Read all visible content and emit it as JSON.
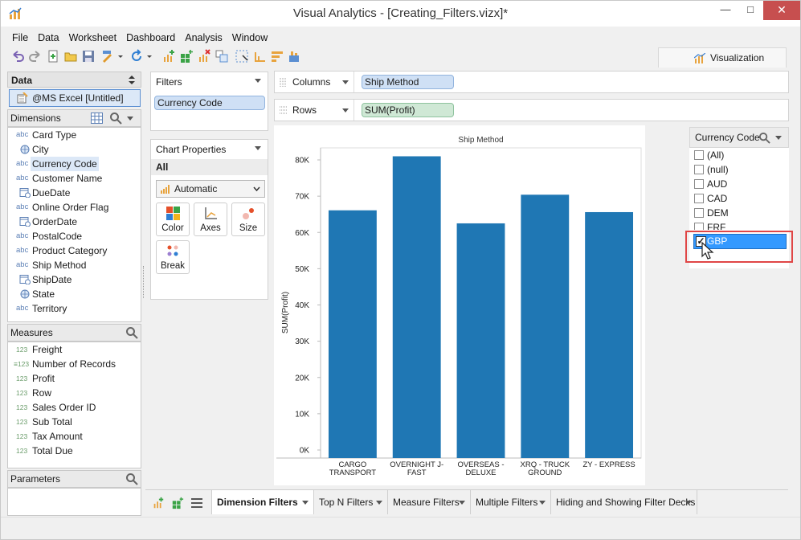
{
  "window": {
    "title": "Visual Analytics - [Creating_Filters.vizx]*",
    "minimize": "—",
    "maximize": "□",
    "close": "✕"
  },
  "menu": [
    "File",
    "Data",
    "Worksheet",
    "Dashboard",
    "Analysis",
    "Window"
  ],
  "visualization_tab": "Visualization",
  "data_panel": {
    "title": "Data",
    "datasource": "@MS Excel [Untitled]",
    "dimensions_title": "Dimensions",
    "dimensions": [
      {
        "type": "abc",
        "label": "Card Type"
      },
      {
        "type": "geo",
        "label": "City"
      },
      {
        "type": "abc",
        "label": "Currency Code",
        "selected": true
      },
      {
        "type": "abc",
        "label": "Customer Name"
      },
      {
        "type": "date",
        "label": "DueDate"
      },
      {
        "type": "abc",
        "label": "Online Order Flag"
      },
      {
        "type": "date",
        "label": "OrderDate"
      },
      {
        "type": "abc",
        "label": "PostalCode"
      },
      {
        "type": "abc",
        "label": "Product Category"
      },
      {
        "type": "abc",
        "label": "Ship Method"
      },
      {
        "type": "date",
        "label": "ShipDate"
      },
      {
        "type": "geo",
        "label": "State"
      },
      {
        "type": "abc",
        "label": "Territory"
      }
    ],
    "measures_title": "Measures",
    "measures": [
      {
        "type": "123",
        "label": "Freight"
      },
      {
        "type": "=123",
        "label": "Number of Records"
      },
      {
        "type": "123",
        "label": "Profit"
      },
      {
        "type": "123",
        "label": "Row"
      },
      {
        "type": "123",
        "label": "Sales Order ID"
      },
      {
        "type": "123",
        "label": "Sub Total"
      },
      {
        "type": "123",
        "label": "Tax Amount"
      },
      {
        "type": "123",
        "label": "Total Due"
      }
    ],
    "parameters_title": "Parameters"
  },
  "filters": {
    "title": "Filters",
    "pill": "Currency Code"
  },
  "chart_properties": {
    "title": "Chart Properties",
    "all_label": "All",
    "mark_type": "Automatic",
    "buttons": [
      "Color",
      "Axes",
      "Size",
      "Break"
    ]
  },
  "shelves": {
    "columns_label": "Columns",
    "columns_pill": "Ship Method",
    "rows_label": "Rows",
    "rows_pill": "SUM(Profit)"
  },
  "chart_data": {
    "type": "bar",
    "title": "Ship Method",
    "ylabel": "SUM(Profit)",
    "categories": [
      "CARGO TRANSPORT",
      "OVERNIGHT J-FAST",
      "OVERSEAS - DELUXE",
      "XRQ - TRUCK GROUND",
      "ZY - EXPRESS"
    ],
    "category_lines": [
      [
        "CARGO",
        "TRANSPORT"
      ],
      [
        "OVERNIGHT J-",
        "FAST"
      ],
      [
        "OVERSEAS -",
        "DELUXE"
      ],
      [
        "XRQ - TRUCK",
        "GROUND"
      ],
      [
        "ZY - EXPRESS"
      ]
    ],
    "values": [
      66100,
      81000,
      62500,
      70400,
      65600
    ],
    "ylim": [
      0,
      80000
    ],
    "yticks": [
      0,
      10000,
      20000,
      30000,
      40000,
      50000,
      60000,
      70000,
      80000
    ],
    "ytick_labels": [
      "0K",
      "10K",
      "20K",
      "30K",
      "40K",
      "50K",
      "60K",
      "70K",
      "80K"
    ],
    "bar_color": "#1f77b4",
    "grid": false
  },
  "quick_filter": {
    "title": "Currency Code",
    "items": [
      {
        "label": "(All)",
        "checked": false
      },
      {
        "label": "(null)",
        "checked": false
      },
      {
        "label": "AUD",
        "checked": false
      },
      {
        "label": "CAD",
        "checked": false
      },
      {
        "label": "DEM",
        "checked": false
      },
      {
        "label": "FRF",
        "checked": false
      }
    ],
    "selected": {
      "label": "GBP",
      "checked": true
    }
  },
  "sheet_tabs": [
    {
      "label": "Dimension Filters",
      "active": true
    },
    {
      "label": "Top N Filters",
      "active": false
    },
    {
      "label": "Measure Filters",
      "active": false
    },
    {
      "label": "Multiple Filters",
      "active": false
    },
    {
      "label": "Hiding and Showing Filter Decks",
      "active": false
    }
  ]
}
